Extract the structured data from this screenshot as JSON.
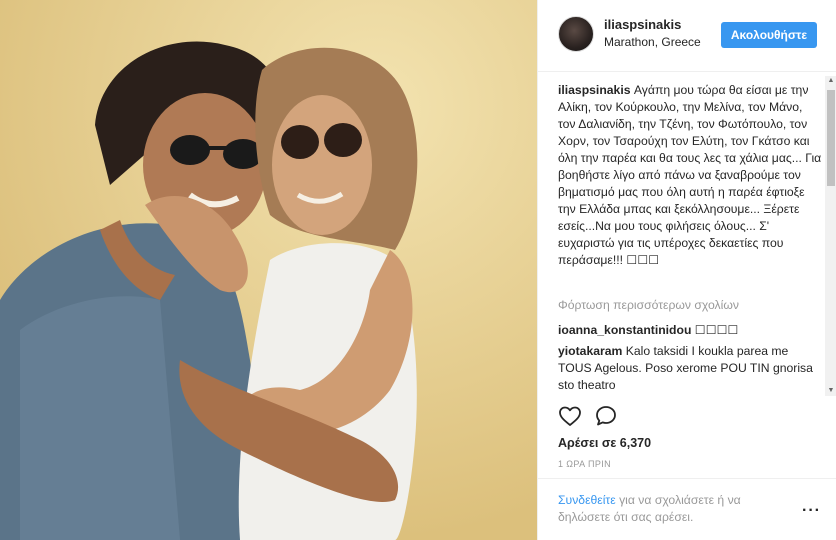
{
  "post": {
    "username": "iliaspsinakis",
    "location": "Marathon, Greece",
    "follow_label": "Ακολουθήστε",
    "caption": "Αγάπη μου τώρα θα είσαι με την Αλίκη, τον Κούρκουλο, την Μελίνα, τον Μάνο, τον Δαλιανίδη, την Τζένη, τον Φωτόπουλο, τον Χορν, τον Τσαρούχη τον Ελύτη, τον Γκάτσο και όλη την παρέα και θα τους λες τα χάλια μας... Για βοηθήστε λίγο από πάνω να ξαναβρούμε τον βηματισμό μας που όλη αυτή η παρέα έφτιοξε την Ελλάδα μπας και ξεκόλλησουμε... Ξέρετε εσείς...Να μου τους φιλήσεις όλους... Σ' ευχαριστώ για τις υπέροχες δεκαετίες που περάσαμε!!! ☐☐☐",
    "load_more_label": "Φόρτωση περισσότερων σχολίων",
    "comments": [
      {
        "user": "ioanna_konstantinidou",
        "text": "☐☐☐☐"
      },
      {
        "user": "yiotakaram",
        "text": "Kalo taksidi I koukla parea me TOUS Agelous. Poso xerome POU TIN gnorisa sto theatro"
      }
    ],
    "likes_label": "Αρέσει σε 6,370",
    "time_label": "1 ΩΡΑ ΠΡΙΝ",
    "login_link": "Συνδεθείτε",
    "login_text": "για να σχολιάσετε ή να δηλώσετε ότι σας αρέσει.",
    "more_icon": "more-options-icon",
    "like_icon": "heart-icon",
    "comment_icon": "comment-bubble-icon",
    "accent_color": "#3897f0"
  }
}
